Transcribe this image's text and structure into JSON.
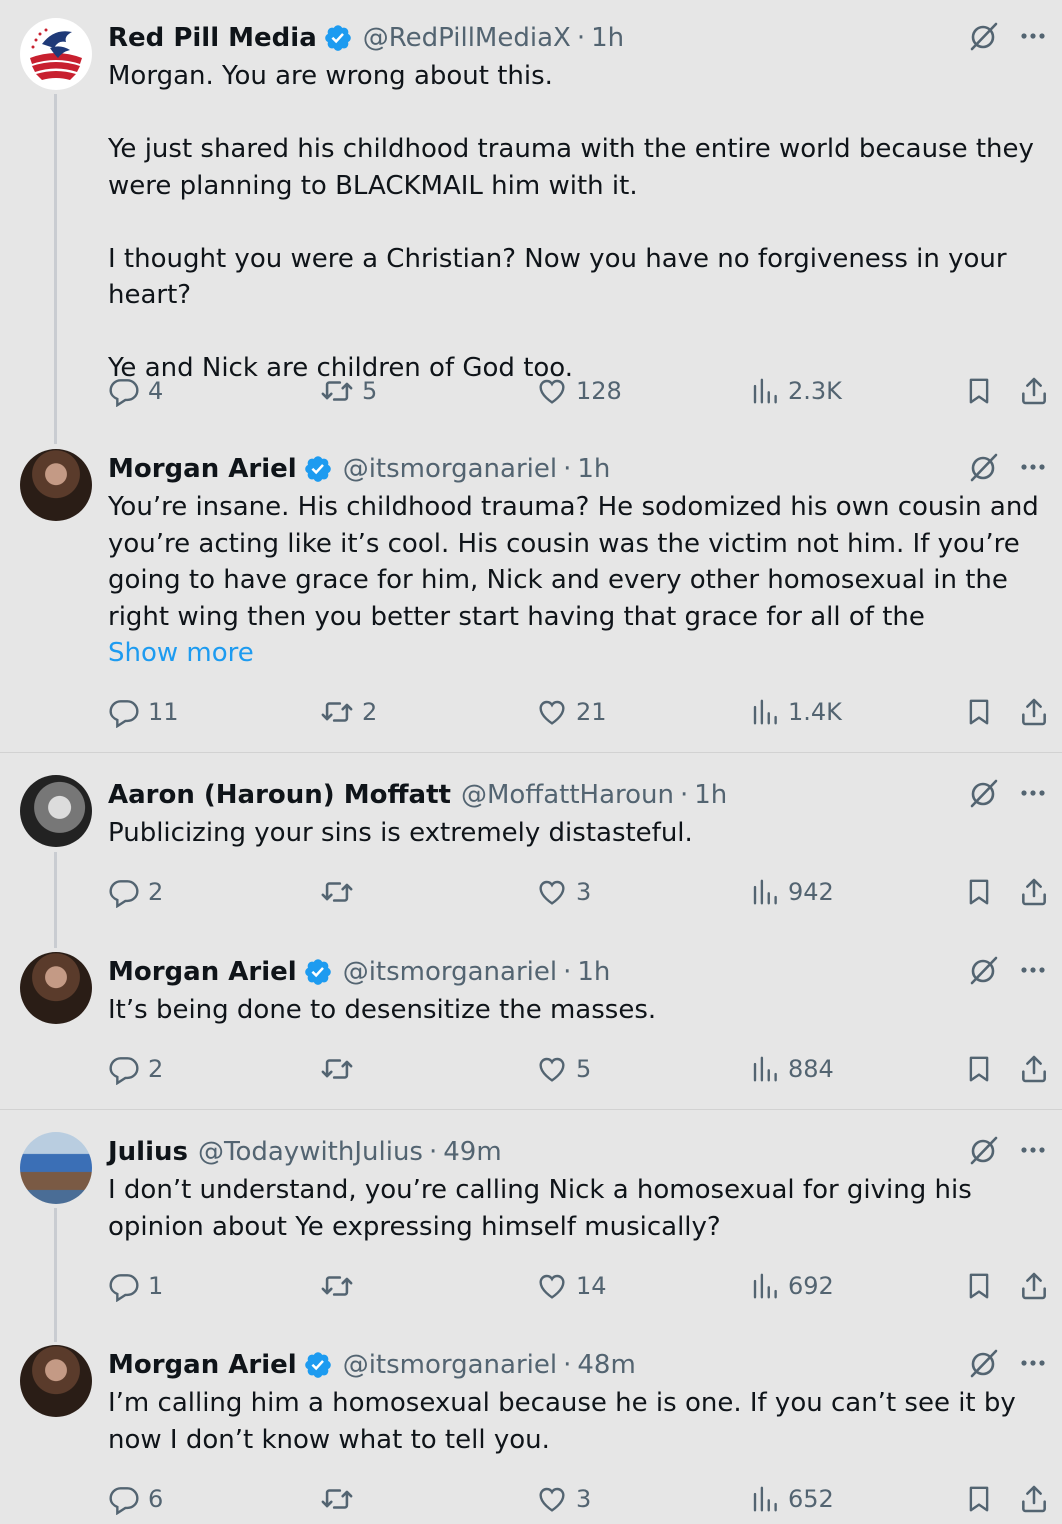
{
  "tweets": [
    {
      "name": "Red Pill Media",
      "handle": "@RedPillMediaX",
      "time": "1h",
      "verified": true,
      "paragraphs": [
        "Morgan. You are wrong about this.",
        "Ye just shared his childhood trauma with the entire world because they were planning to BLACKMAIL him with it.",
        "I thought you were a Christian? Now you have no forgiveness in your heart?",
        "Ye and Nick are children of God too."
      ],
      "show_more": "",
      "replies": "4",
      "retweets": "5",
      "likes": "128",
      "views": "2.3K"
    },
    {
      "name": "Morgan Ariel",
      "handle": "@itsmorganariel",
      "time": "1h",
      "verified": true,
      "paragraphs": [
        "You’re insane. His childhood trauma? He sodomized his own cousin and you’re acting like it’s cool. His cousin was the victim not him. If you’re going to have grace for him, Nick and every other homosexual in the right wing then you better start having that grace for all of the"
      ],
      "show_more": "Show more",
      "replies": "11",
      "retweets": "2",
      "likes": "21",
      "views": "1.4K"
    },
    {
      "name": "Aaron (Haroun) Moffatt",
      "handle": "@MoffattHaroun",
      "time": "1h",
      "verified": false,
      "paragraphs": [
        "Publicizing your sins is extremely distasteful."
      ],
      "show_more": "",
      "replies": "2",
      "retweets": "",
      "likes": "3",
      "views": "942"
    },
    {
      "name": "Morgan Ariel",
      "handle": "@itsmorganariel",
      "time": "1h",
      "verified": true,
      "paragraphs": [
        "It’s being done to desensitize the masses."
      ],
      "show_more": "",
      "replies": "2",
      "retweets": "",
      "likes": "5",
      "views": "884"
    },
    {
      "name": "Julius",
      "handle": "@TodaywithJulius",
      "time": "49m",
      "verified": false,
      "paragraphs": [
        "I don’t understand, you’re calling Nick a homosexual for giving his opinion about Ye expressing himself musically?"
      ],
      "show_more": "",
      "replies": "1",
      "retweets": "",
      "likes": "14",
      "views": "692"
    },
    {
      "name": "Morgan Ariel",
      "handle": "@itsmorganariel",
      "time": "48m",
      "verified": true,
      "paragraphs": [
        "I’m calling him a homosexual because he is one. If you can’t see it by now I don’t know what to tell you."
      ],
      "show_more": "",
      "replies": "6",
      "retweets": "",
      "likes": "3",
      "views": "652"
    }
  ],
  "colors": {
    "background": "#e6e6e6",
    "text": "#0f1419",
    "muted": "#536471",
    "link": "#1d9bf0",
    "verified": "#1d9bf0"
  },
  "icons": [
    "verified-badge-icon",
    "grok-icon",
    "more-icon",
    "reply-icon",
    "retweet-icon",
    "like-icon",
    "views-icon",
    "bookmark-icon",
    "share-icon"
  ]
}
